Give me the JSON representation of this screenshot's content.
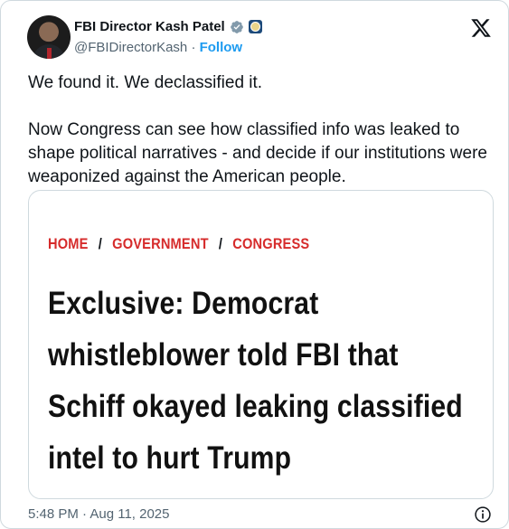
{
  "author": {
    "name": "FBI Director Kash Patel",
    "handle": "@FBIDirectorKash",
    "separator": "·",
    "follow_label": "Follow"
  },
  "tweet": {
    "text": "We found it. We declassified it.\n\nNow Congress can see how classified info was leaked to shape political narratives - and decide if our institutions were weaponized against the American people."
  },
  "article": {
    "breadcrumbs": [
      "HOME",
      "GOVERNMENT",
      "CONGRESS"
    ],
    "breadcrumb_separator": "/",
    "headline": "Exclusive: Democrat whistleblower told FBI that Schiff okayed leaking classified intel to hurt Trump"
  },
  "footer": {
    "timestamp": "5:48 PM · Aug 11, 2025"
  },
  "colors": {
    "breadcrumb": "#d62b2b",
    "follow": "#1d9bf0",
    "verified": "#829aab"
  }
}
